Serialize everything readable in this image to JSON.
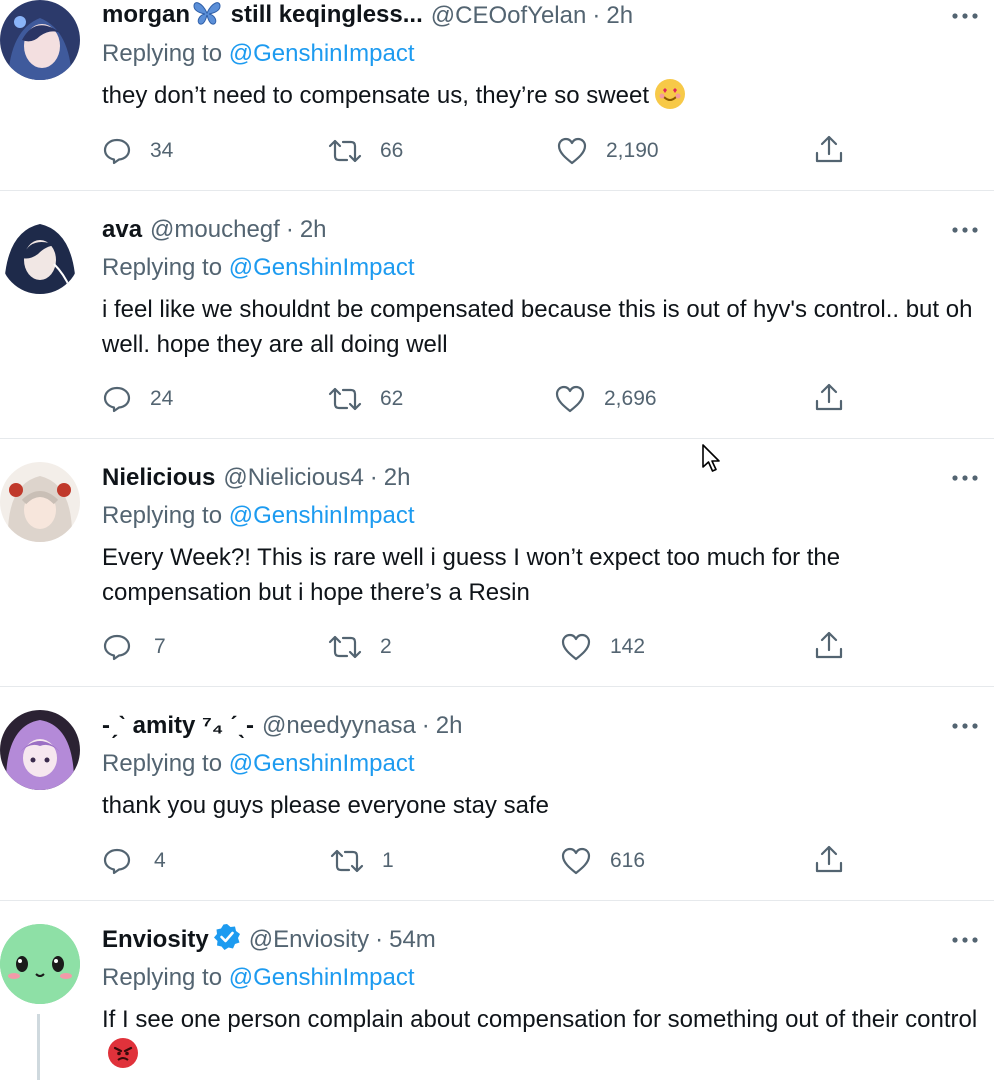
{
  "replying_label": "Replying to",
  "tweets": [
    {
      "name": "morgan",
      "name_suffix": " still keqingless...",
      "handle": "@CEOofYelan",
      "time": "2h",
      "reply_to": "@GenshinImpact",
      "text": "they don’t need to compensate us, they’re so sweet",
      "emoji": "smiling-face-with-heart-eyes",
      "replies": "34",
      "retweets": "66",
      "likes": "2,190"
    },
    {
      "name": "ava",
      "handle": "@mouchegf",
      "time": "2h",
      "reply_to": "@GenshinImpact",
      "text": "i feel like we shouldnt be compensated because this is out of hyv's control.. but oh well. hope they are all doing well",
      "replies": "24",
      "retweets": "62",
      "likes": "2,696"
    },
    {
      "name": "Nielicious",
      "handle": "@Nielicious4",
      "time": "2h",
      "reply_to": "@GenshinImpact",
      "text": "Every Week?! This is rare well i guess I won’t expect too much for the compensation but i hope there’s a Resin",
      "replies": "7",
      "retweets": "2",
      "likes": "142"
    },
    {
      "name": "-ˏˋ amity ⁷₄ ˊˎ-",
      "handle": "@needyynasa",
      "time": "2h",
      "reply_to": "@GenshinImpact",
      "text": "thank you guys please everyone stay safe",
      "replies": "4",
      "retweets": "1",
      "likes": "616"
    },
    {
      "name": "Enviosity",
      "verified": true,
      "handle": "@Enviosity",
      "time": "54m",
      "reply_to": "@GenshinImpact",
      "text": "If I see one person complain about compensation for something out of their control",
      "emoji": "angry-face"
    }
  ],
  "colors": {
    "link": "#1d9bf0",
    "secondary": "#536471",
    "divider": "#e6e9ec"
  }
}
